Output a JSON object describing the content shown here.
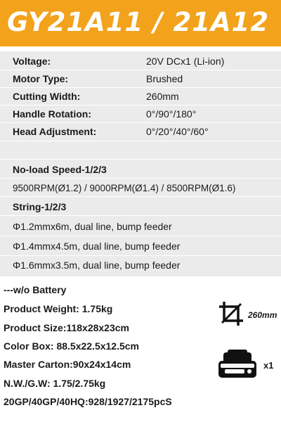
{
  "header": {
    "title": "GY21A11 / 21A12"
  },
  "specs": [
    {
      "label": "Voltage:",
      "value": "20V DCx1 (Li-ion)"
    },
    {
      "label": "Motor Type:",
      "value": "Brushed"
    },
    {
      "label": "Cutting Width:",
      "value": "260mm"
    },
    {
      "label": "Handle Rotation:",
      "value": "0°/90°/180°"
    },
    {
      "label": "Head Adjustment:",
      "value": "0°/20°/40°/60°"
    }
  ],
  "speed": {
    "heading": "No-load Speed-1/2/3",
    "text": "9500RPM(Ø1.2)  /  9000RPM(Ø1.4)  /  8500RPM(Ø1.6)"
  },
  "string": {
    "heading": "String-1/2/3",
    "items": [
      "Φ1.2mmx6m, dual line, bump feeder",
      "Φ1.4mmx4.5m, dual line, bump feeder",
      "Φ1.6mmx3.5m, dual line, bump feeder"
    ]
  },
  "package": {
    "heading": "---w/o Battery",
    "lines": [
      "Product Weight: 1.75kg",
      "Product Size:118x28x23cm",
      "Color Box: 88.5x22.5x12.5cm",
      "Master Carton:90x24x14cm",
      "N.W./G.W: 1.75/2.75kg",
      "20GP/40GP/40HQ:928/1927/2175pcS"
    ]
  },
  "icons": {
    "cut_width_label": "260mm",
    "battery_label": "x1",
    "cut_icon": "crop-icon",
    "battery_icon": "battery-icon"
  },
  "colors": {
    "header": "#f2a21b",
    "panel": "#ebebeb"
  }
}
